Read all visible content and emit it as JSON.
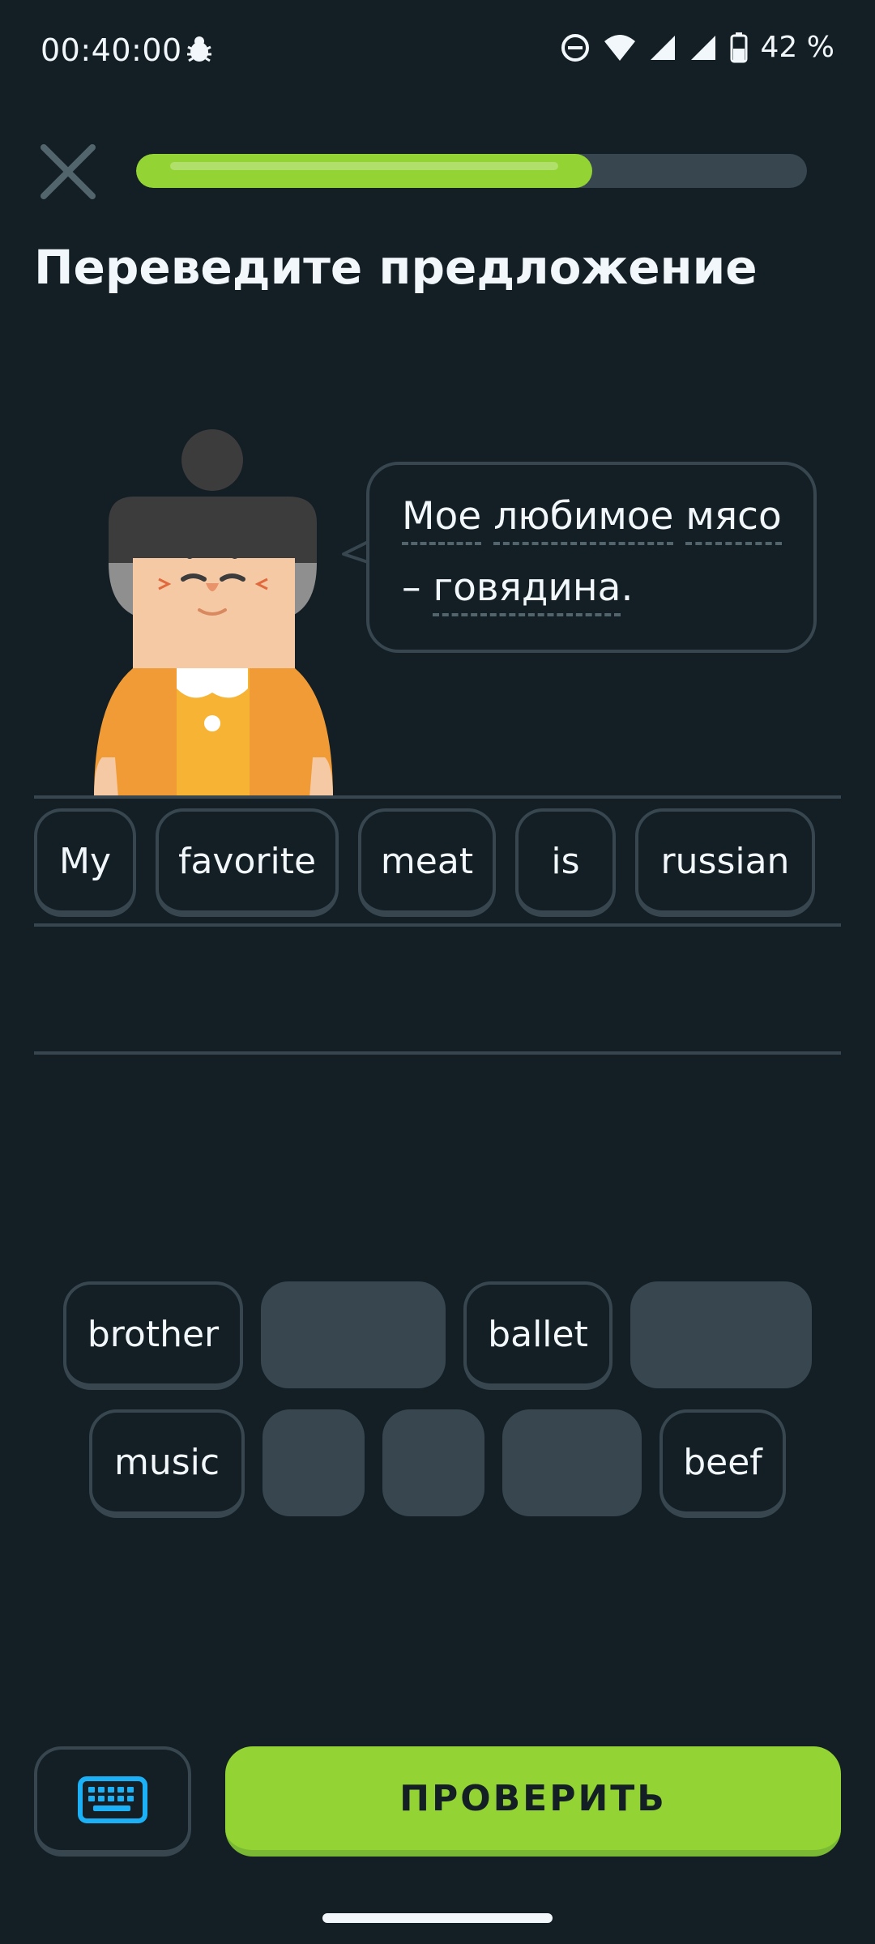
{
  "status_bar": {
    "time": "00:40:00",
    "battery": "42 %",
    "icons": [
      "bug-icon",
      "do-not-disturb-icon",
      "wifi-icon",
      "signal-icon",
      "signal-icon",
      "battery-icon"
    ]
  },
  "header": {
    "close_icon": "close-icon",
    "progress": 0.68
  },
  "title": "Переведите предложение",
  "bubble": {
    "words_line1": [
      "Мое",
      "любимое",
      "мясо"
    ],
    "line2_dash": "–",
    "line2_word": "говядина",
    "line2_period": "."
  },
  "answer": {
    "words": [
      "My",
      "favorite",
      "meat",
      "is",
      "russian"
    ]
  },
  "bank": {
    "row1": [
      {
        "label": "brother",
        "used": false
      },
      {
        "label": "",
        "used": true
      },
      {
        "label": "ballet",
        "used": false
      },
      {
        "label": "",
        "used": true
      }
    ],
    "row2": [
      {
        "label": "music",
        "used": false
      },
      {
        "label": "",
        "used": true
      },
      {
        "label": "",
        "used": true
      },
      {
        "label": "",
        "used": true
      },
      {
        "label": "beef",
        "used": false
      }
    ]
  },
  "footer": {
    "keyboard_icon": "keyboard-icon",
    "check_label": "ПРОВЕРИТЬ"
  },
  "colors": {
    "background": "#131f24",
    "accent_green": "#93d333",
    "border": "#37464f",
    "keyboard_blue": "#1cb0f6"
  }
}
